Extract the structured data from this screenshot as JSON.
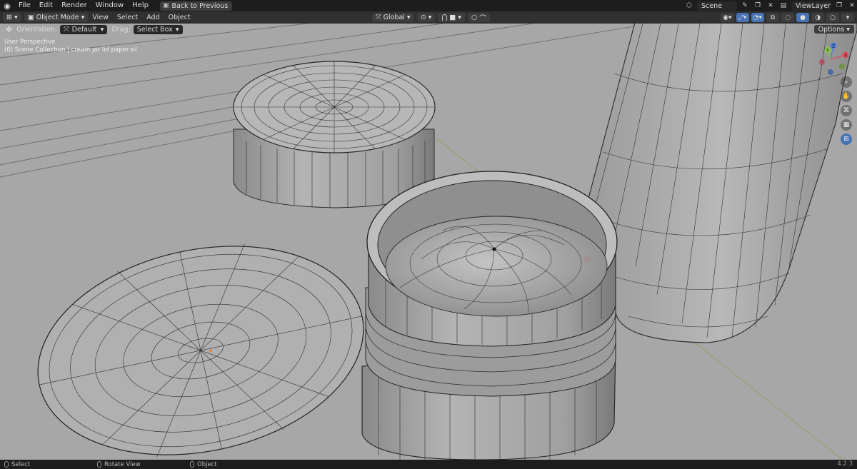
{
  "topbar": {
    "menus": [
      "File",
      "Edit",
      "Render",
      "Window",
      "Help"
    ],
    "back_label": "Back to Previous",
    "scene_name": "Scene",
    "view_layer": "ViewLayer"
  },
  "header": {
    "mode": "Object Mode",
    "menus": [
      "View",
      "Select",
      "Add",
      "Object"
    ],
    "transform_orientation": "Global"
  },
  "toolheader": {
    "orientation_label": "Orientation:",
    "orientation_value": "Default",
    "drag_label": "Drag:",
    "drag_value": "Select Box",
    "options_label": "Options"
  },
  "viewport": {
    "perspective": "User Perspective",
    "collection_path": "(0) Scene Collection | cream jar lid paper.sil",
    "gizmo_axes": [
      "Y",
      "Z",
      "X"
    ]
  },
  "statusbar": {
    "items": [
      "Select",
      "Rotate View",
      "Object"
    ],
    "version": "4.2.3"
  },
  "colors": {
    "accent": "#4772b3",
    "viewport_bg": "#a7a7a7",
    "axis_x": "#e04b5a",
    "axis_y": "#8bc34a",
    "axis_z": "#4d7fe0"
  }
}
